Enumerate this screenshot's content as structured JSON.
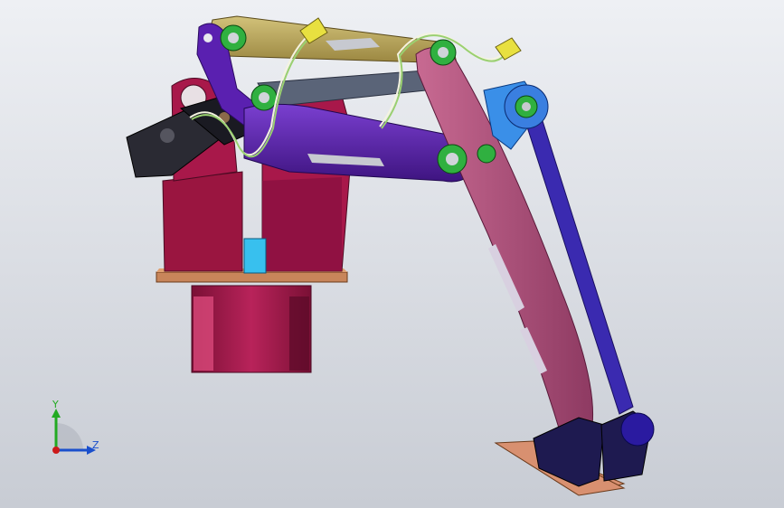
{
  "viewport": {
    "background_top": "#eef0f4",
    "background_bottom": "#c8ccd4"
  },
  "triad": {
    "y_label": "Y",
    "z_label": "Z",
    "y_color": "#22aa22",
    "z_color": "#1a4fcc",
    "x_color": "#cc1a1a"
  },
  "parts": {
    "base_color": "#a01545",
    "base_plate_color": "#c8855a",
    "servo_color": "#2a2a33",
    "upper_link_color": "#b8a45a",
    "grey_link_color": "#5a6478",
    "main_arm_color": "#5a1fa0",
    "forearm_color": "#b0507a",
    "parallel_link_color": "#3a2ab0",
    "joint_hub_color": "#3a7fe0",
    "gripper_color": "#1e1a50",
    "foot_plate_color": "#d89070",
    "bearing_color": "#30b040",
    "connector_color": "#e8e040",
    "shaft_color": "#30b8e8"
  }
}
